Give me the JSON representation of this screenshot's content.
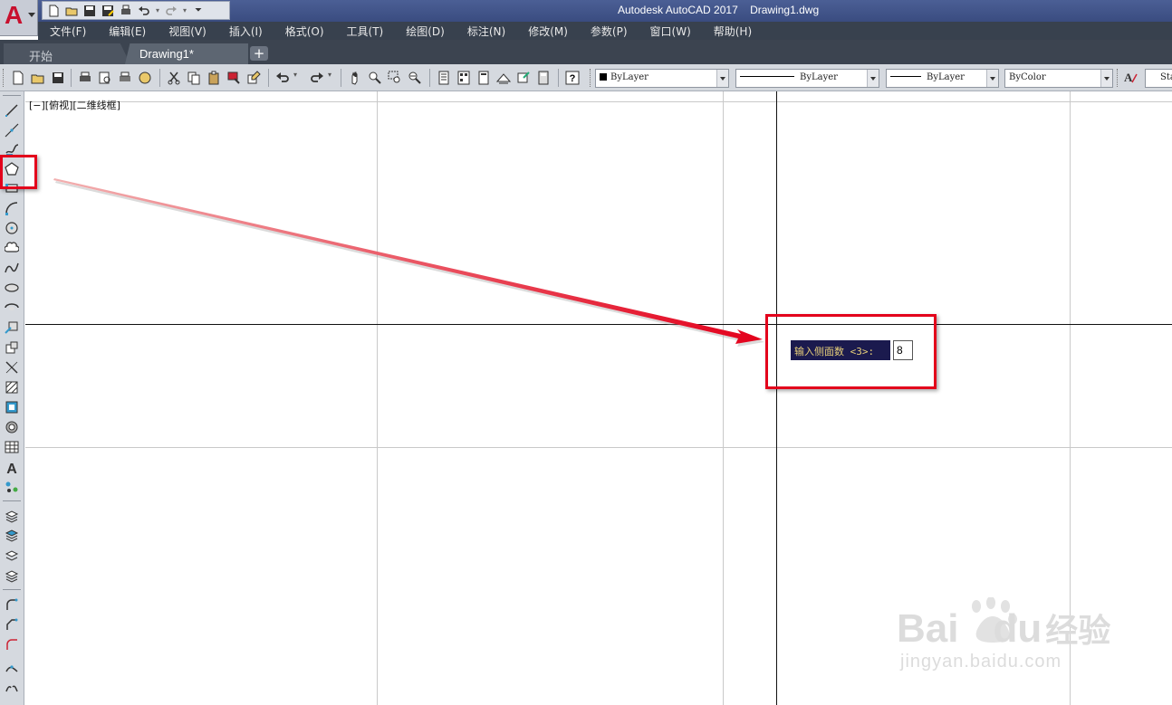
{
  "window": {
    "title": "Autodesk AutoCAD 2017    Drawing1.dwg",
    "app_logo": "A"
  },
  "menu": [
    "文件(F)",
    "编辑(E)",
    "视图(V)",
    "插入(I)",
    "格式(O)",
    "工具(T)",
    "绘图(D)",
    "标注(N)",
    "修改(M)",
    "参数(P)",
    "窗口(W)",
    "帮助(H)"
  ],
  "tabs": {
    "start": "开始",
    "drawing": "Drawing1*",
    "close": "×",
    "add": "+"
  },
  "properties": {
    "color": "ByLayer",
    "linetype": "ByLayer",
    "lineweight": "ByLayer",
    "plotstyle": "ByColor",
    "textstyle": "Sta"
  },
  "viewport": {
    "label": "[−][俯视][二维线框]"
  },
  "command_prompt": {
    "label": "输入侧面数 <3>:",
    "value": "8"
  },
  "watermark": {
    "brand": "Bai",
    "brand2": "du",
    "cn": "经验",
    "url": "jingyan.baidu.com"
  },
  "colors": {
    "highlight": "#e3001b",
    "prompt_bg": "#1b1a4e",
    "prompt_text": "#e8d07a",
    "titlebar": "#4b5f95",
    "menubar": "#38414e"
  },
  "icons": {
    "draw_toolbar": [
      "line-icon",
      "construction-line-icon",
      "polyline-icon",
      "polygon-icon",
      "rectangle-icon",
      "arc-icon",
      "circle-icon",
      "revision-cloud-icon",
      "spline-icon",
      "ellipse-icon",
      "ellipse-arc-icon",
      "insert-block-icon",
      "make-block-icon",
      "point-icon",
      "hatch-icon",
      "gradient-icon",
      "region-icon",
      "table-icon",
      "multiline-text-icon",
      "add-selected-icon"
    ]
  }
}
